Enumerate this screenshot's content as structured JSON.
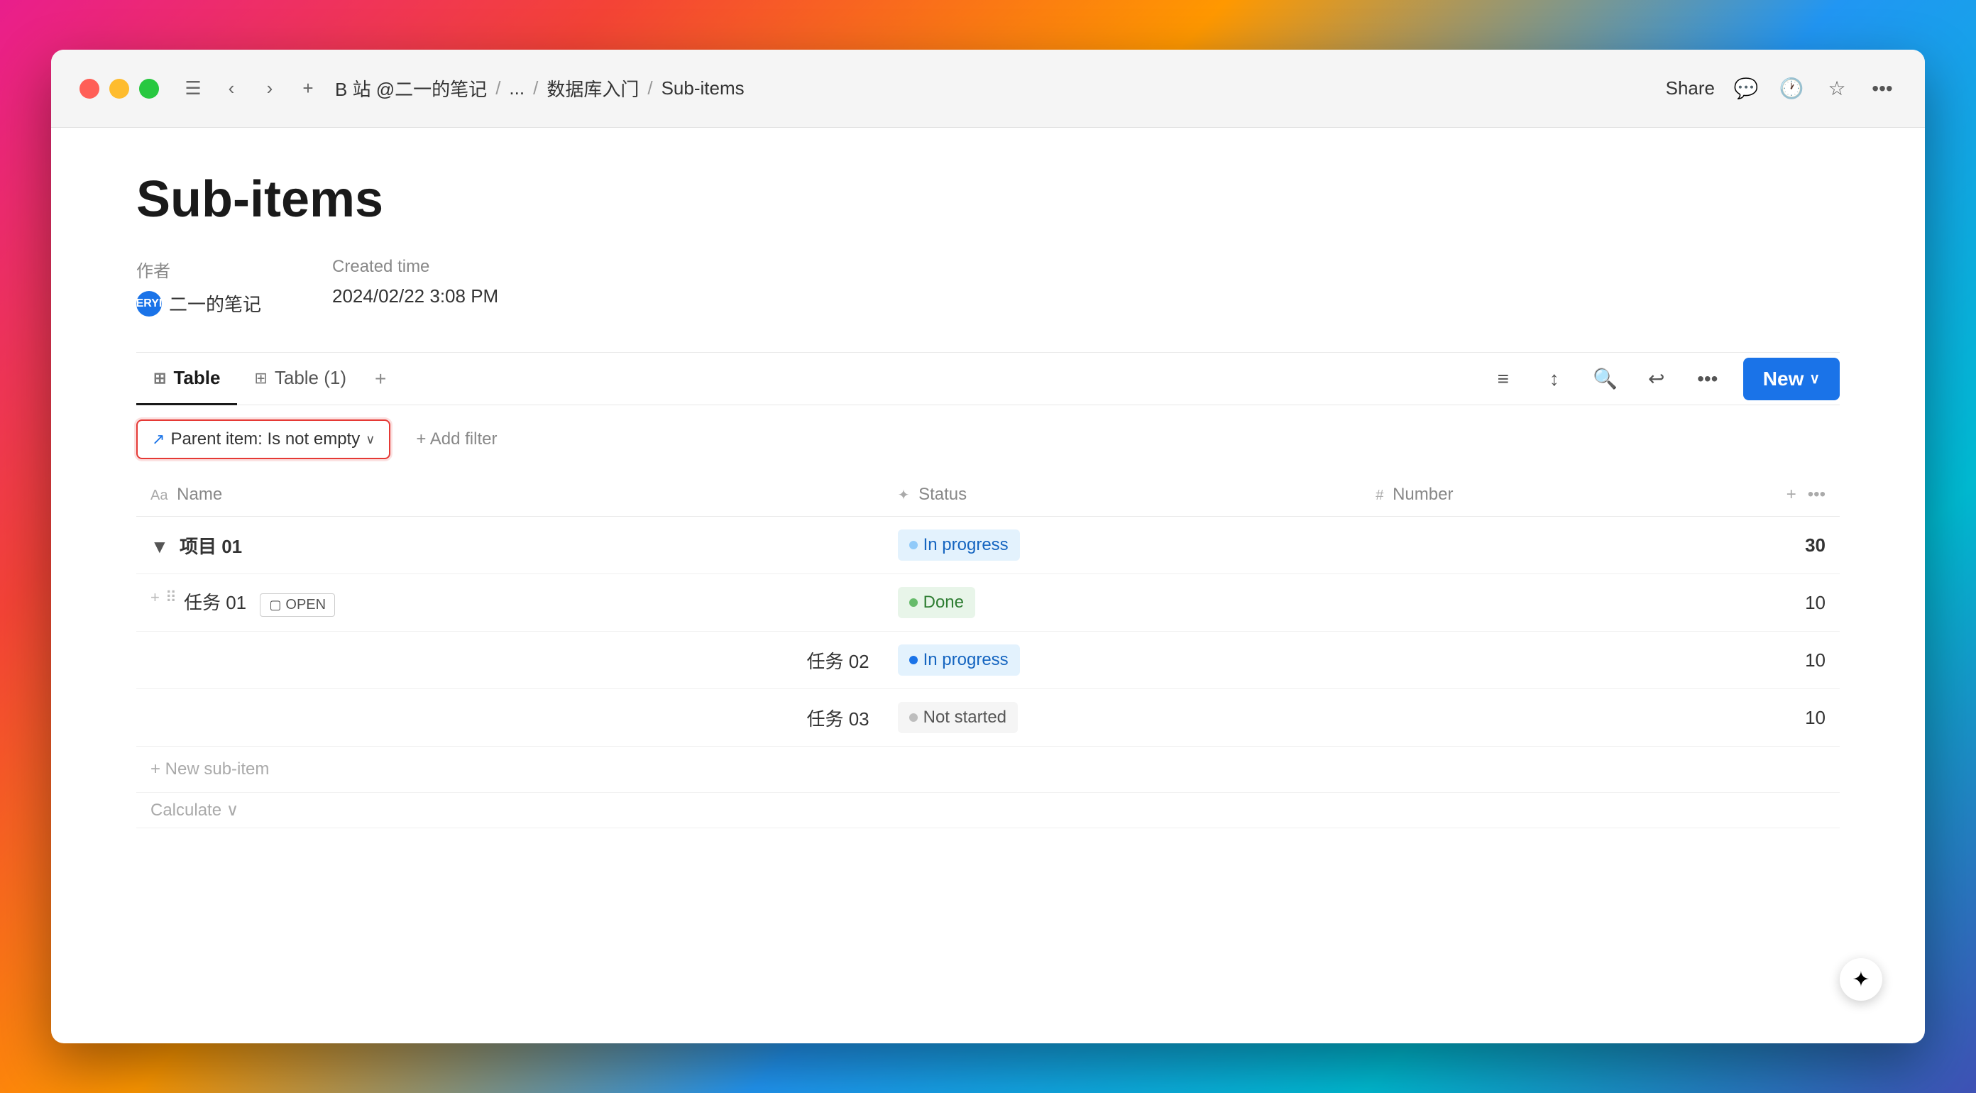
{
  "titlebar": {
    "breadcrumb": [
      "B 站 @二一的笔记",
      "...",
      "数据库入门",
      "Sub-items"
    ],
    "share_label": "Share"
  },
  "page": {
    "title": "Sub-items",
    "meta": {
      "author_label": "作者",
      "created_label": "Created time",
      "author_name": "二一的笔记",
      "avatar_text": "ERYI",
      "created_date": "2024/02/22 3:08 PM"
    }
  },
  "tabs": {
    "items": [
      {
        "label": "Table",
        "active": true
      },
      {
        "label": "Table (1)",
        "active": false
      }
    ],
    "add_label": "+"
  },
  "toolbar": {
    "new_label": "New"
  },
  "filter": {
    "chip_icon": "↗",
    "chip_text": "Parent item: Is not empty",
    "chip_arrow": "∨",
    "add_filter_label": "+ Add filter"
  },
  "table": {
    "columns": [
      {
        "icon": "Aa",
        "label": "Name"
      },
      {
        "icon": "✦",
        "label": "Status"
      },
      {
        "icon": "#",
        "label": "Number"
      }
    ],
    "rows": [
      {
        "type": "group",
        "name": "项目 01",
        "status": "In progress",
        "status_type": "in-progress-light",
        "number": "30"
      },
      {
        "type": "item",
        "name": "任务 01",
        "has_open": true,
        "open_label": "OPEN",
        "status": "Done",
        "status_type": "done",
        "number": "10"
      },
      {
        "type": "item",
        "name": "任务 02",
        "has_open": false,
        "status": "In progress",
        "status_type": "in-progress",
        "number": "10"
      },
      {
        "type": "item",
        "name": "任务 03",
        "has_open": false,
        "status": "Not started",
        "status_type": "not-started",
        "number": "10"
      }
    ],
    "new_subitem_label": "+ New sub-item",
    "calculate_label": "Calculate",
    "calculate_arrow": "∨"
  },
  "colors": {
    "accent": "#1a73e8",
    "filter_border": "#e53935"
  }
}
